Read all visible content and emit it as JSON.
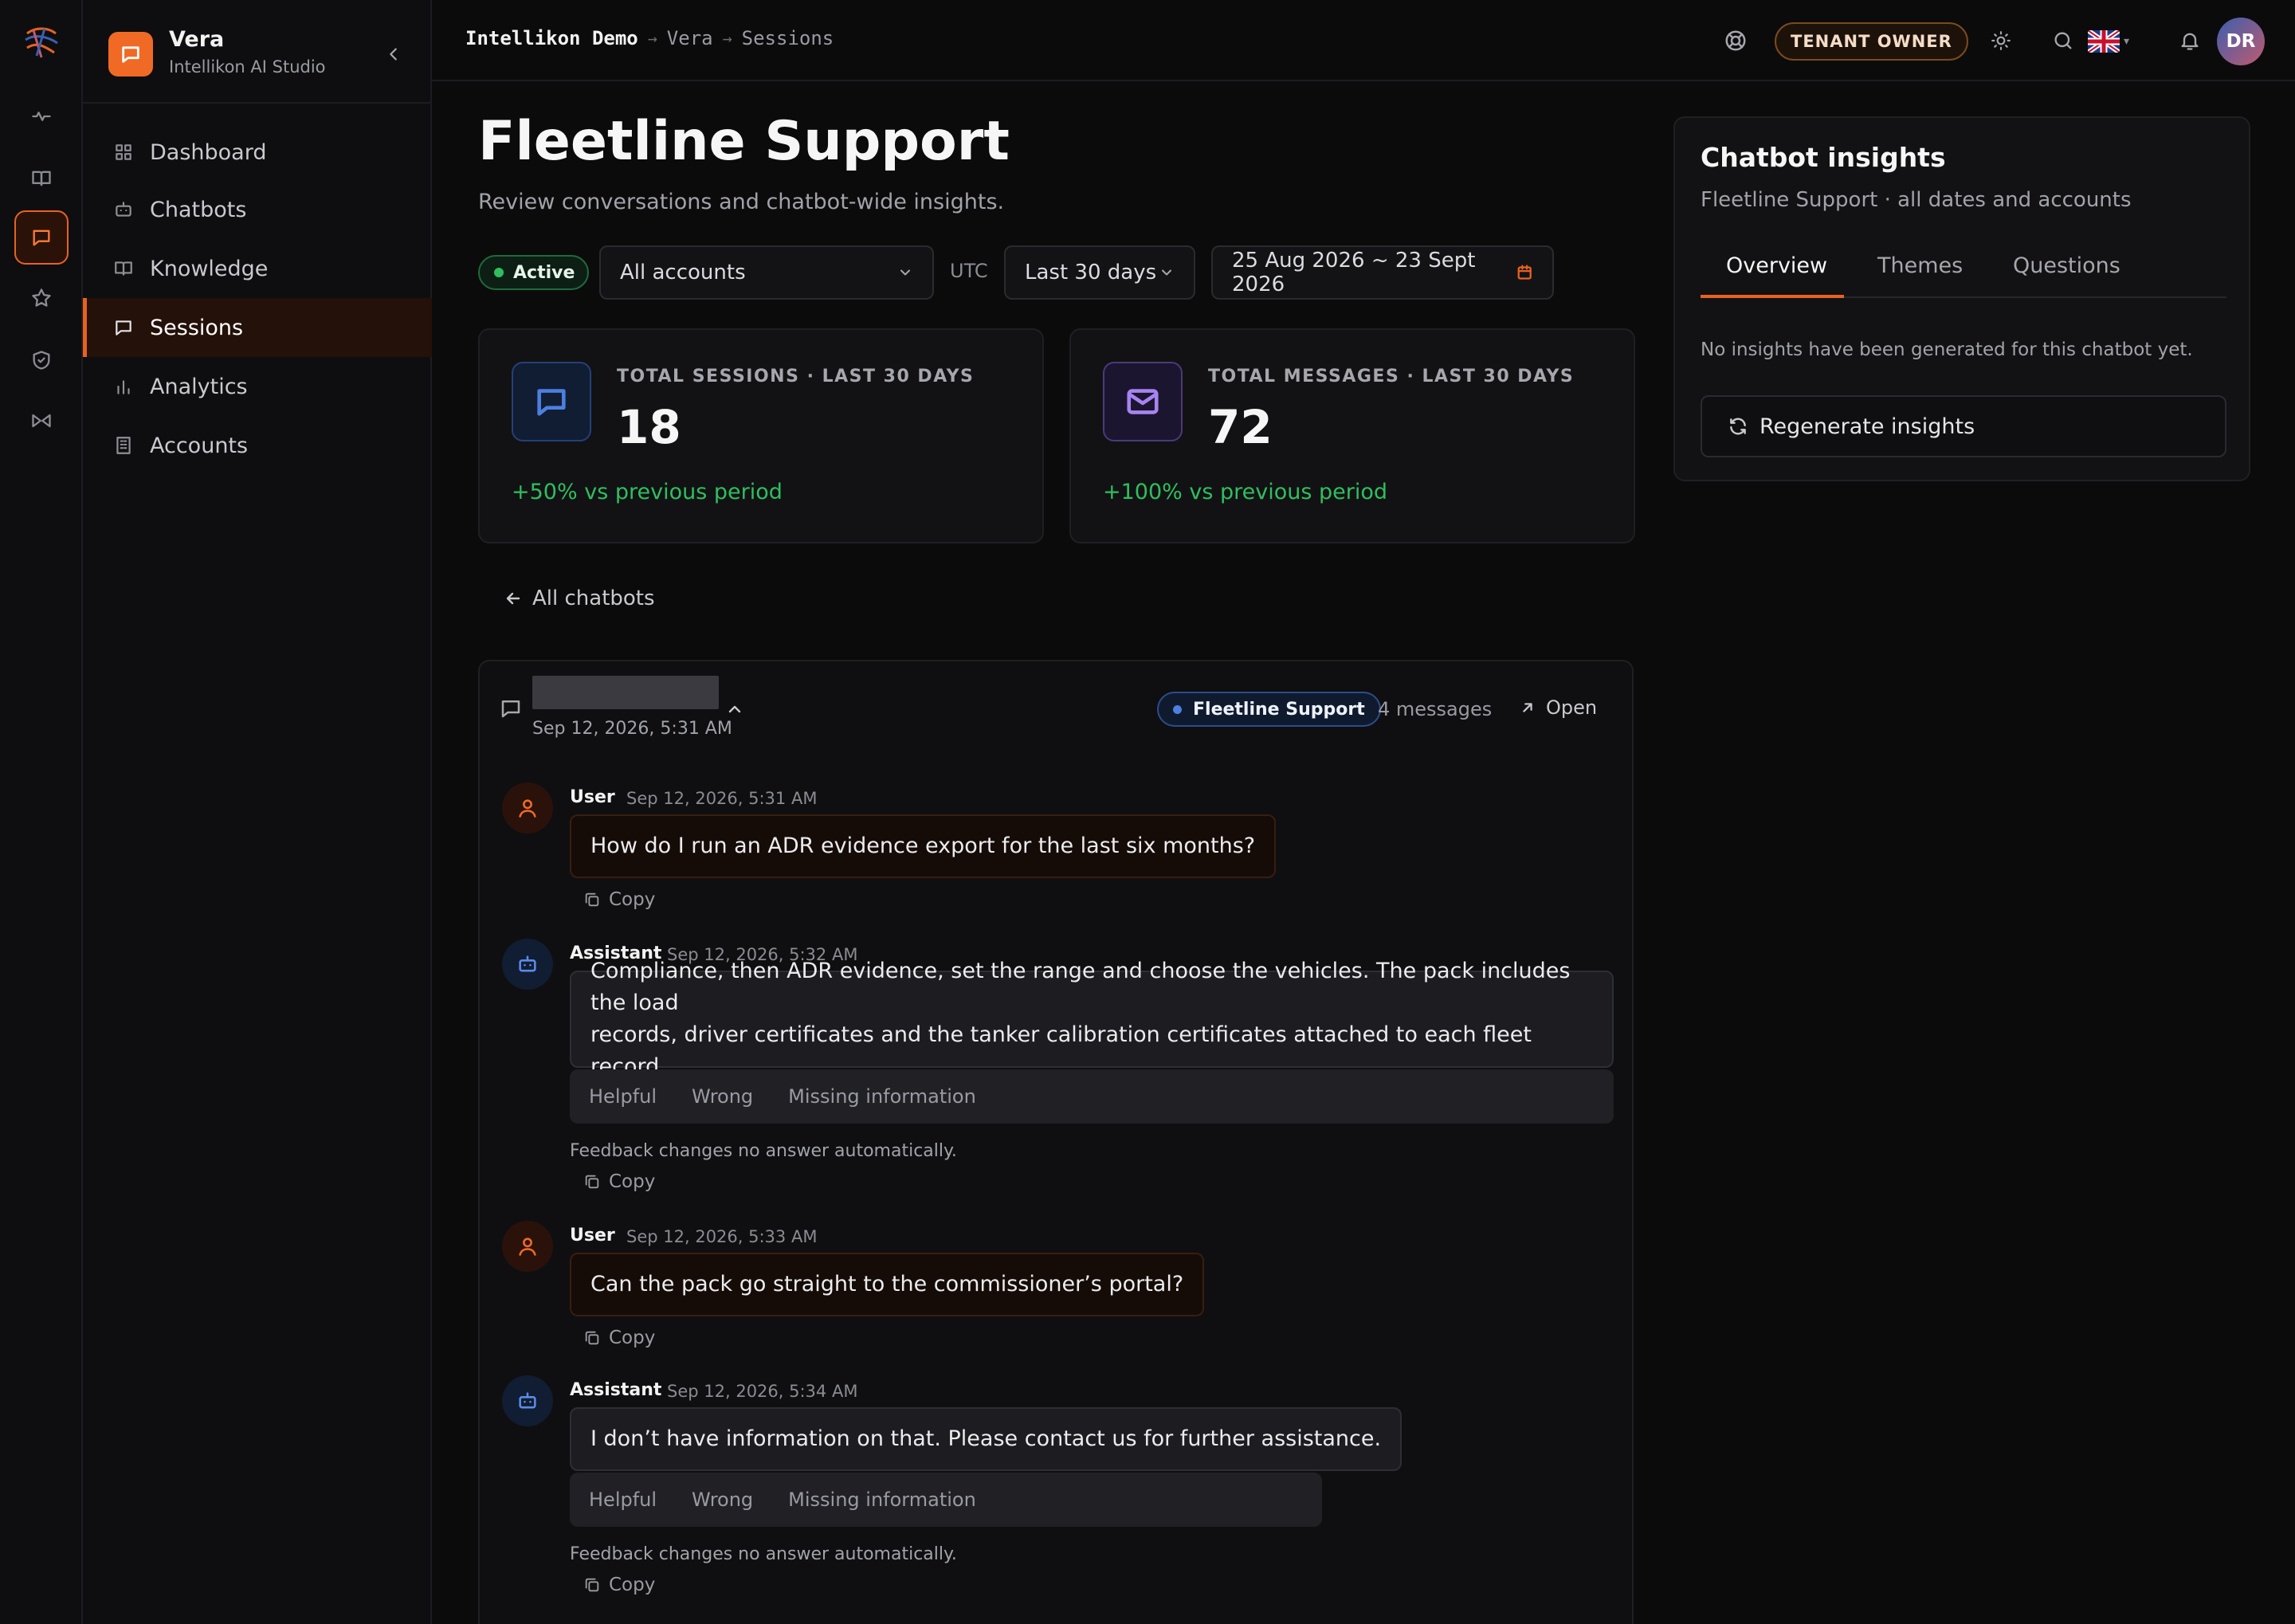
{
  "app": {
    "name": "Vera",
    "subtitle": "Intellikon AI Studio",
    "accent": "#e8621f"
  },
  "sidebar": {
    "items": [
      {
        "label": "Dashboard",
        "icon": "grid-icon",
        "active": false
      },
      {
        "label": "Chatbots",
        "icon": "bot-icon",
        "active": false
      },
      {
        "label": "Knowledge",
        "icon": "book-icon",
        "active": false
      },
      {
        "label": "Sessions",
        "icon": "chat-icon",
        "active": true
      },
      {
        "label": "Analytics",
        "icon": "bar-chart-icon",
        "active": false
      },
      {
        "label": "Accounts",
        "icon": "building-icon",
        "active": false
      }
    ]
  },
  "rail": {
    "icons": [
      "logo-icon",
      "activity-icon",
      "book-icon",
      "chat-icon",
      "star-icon",
      "shield-icon",
      "bowtie-icon"
    ],
    "active": "chat-icon"
  },
  "topbar": {
    "breadcrumb": [
      "Intellikon Demo",
      "Vera",
      "Sessions"
    ],
    "role_badge": "TENANT OWNER",
    "avatar_initials": "DR",
    "language_flag": "uk-flag-icon"
  },
  "page": {
    "title": "Fleetline Support",
    "subtitle": "Review conversations and chatbot-wide insights."
  },
  "filters": {
    "status": "Active",
    "accounts": "All accounts",
    "timezone": "UTC",
    "range": "Last 30 days",
    "date_range": "25 Aug 2026 ~ 23 Sept 2026"
  },
  "stats": [
    {
      "label": "TOTAL SESSIONS · LAST 30 DAYS",
      "value": "18",
      "delta": "+50% vs previous period",
      "icon": "chat-icon",
      "color": "#4c7fe0"
    },
    {
      "label": "TOTAL MESSAGES · LAST 30 DAYS",
      "value": "72",
      "delta": "+100% vs previous period",
      "icon": "mail-icon",
      "color": "#a684f0"
    }
  ],
  "back_link": "All chatbots",
  "session": {
    "date": "Sep 12, 2026, 5:31 AM",
    "chatbot": "Fleetline Support",
    "message_count": "4 messages",
    "open_label": "Open",
    "copy_label": "Copy",
    "feedback_options": [
      "Helpful",
      "Wrong",
      "Missing information"
    ],
    "feedback_note": "Feedback changes no answer automatically.",
    "messages": [
      {
        "role": "User",
        "time": "Sep 12, 2026, 5:31 AM",
        "text": "How do I run an ADR evidence export for the last six months?"
      },
      {
        "role": "Assistant",
        "time": "Sep 12, 2026, 5:32 AM",
        "text_lines": [
          "Compliance, then ADR evidence, set the range and choose the vehicles. The pack includes the load",
          "records, driver certificates and the tanker calibration certificates attached to each fleet record."
        ]
      },
      {
        "role": "User",
        "time": "Sep 12, 2026, 5:33 AM",
        "text": "Can the pack go straight to the commissioner’s portal?"
      },
      {
        "role": "Assistant",
        "time": "Sep 12, 2026, 5:34 AM",
        "text": "I don’t have information on that. Please contact us for further assistance."
      }
    ]
  },
  "insights": {
    "title": "Chatbot insights",
    "subtitle": "Fleetline Support · all dates and accounts",
    "tabs": [
      "Overview",
      "Themes",
      "Questions"
    ],
    "active_tab": "Overview",
    "empty_text": "No insights have been generated for this chatbot yet.",
    "regenerate_label": "Regenerate insights"
  }
}
